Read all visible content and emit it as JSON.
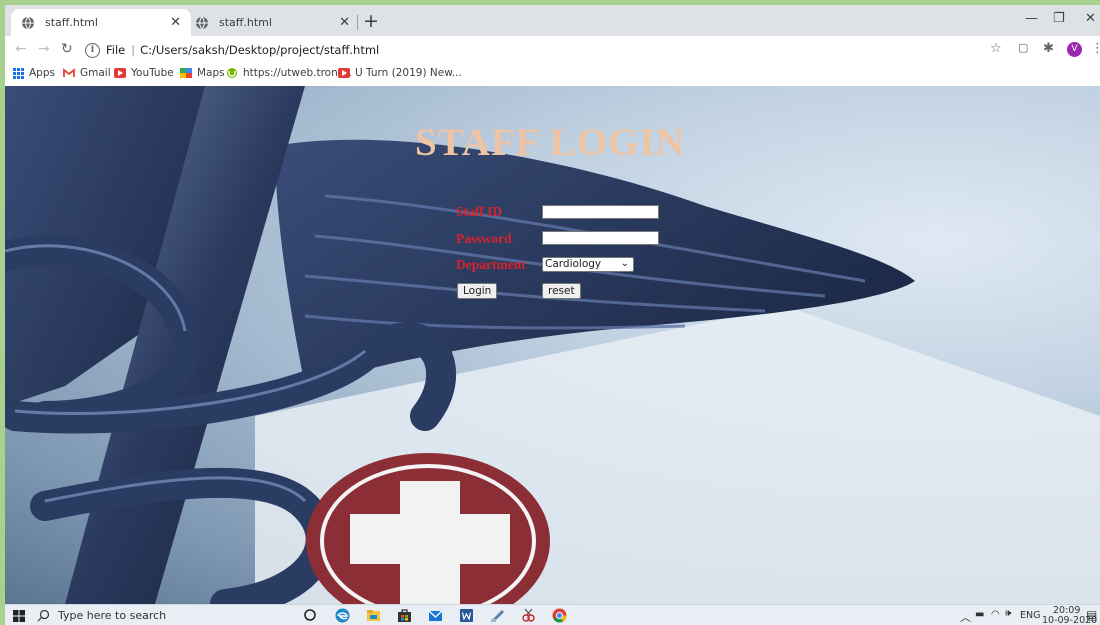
{
  "browser": {
    "tabs": [
      {
        "title": "staff.html",
        "active": true
      },
      {
        "title": "staff.html",
        "active": false
      }
    ],
    "address": {
      "scheme": "File",
      "url": "C:/Users/saksh/Desktop/project/staff.html"
    },
    "profile_initial": "V",
    "bookmarks": [
      {
        "label": "Apps",
        "icon": "apps-grid-icon"
      },
      {
        "label": "Gmail",
        "icon": "gmail-icon"
      },
      {
        "label": "YouTube",
        "icon": "youtube-icon"
      },
      {
        "label": "Maps",
        "icon": "maps-icon"
      },
      {
        "label": "https://utweb.tront...",
        "icon": "utweb-icon"
      },
      {
        "label": "U Turn (2019) New...",
        "icon": "youtube-icon"
      }
    ]
  },
  "page": {
    "title": "STAFF LOGIN",
    "form": {
      "staff_id_label": "Staff ID",
      "staff_id_value": "",
      "password_label": "Password",
      "password_value": "",
      "department_label": "Department",
      "department_selected": "Cardiology",
      "login_button": "Login",
      "reset_button": "reset"
    }
  },
  "taskbar": {
    "search_placeholder": "Type here to search",
    "language": "ENG",
    "time": "20:09",
    "date": "10-09-2020"
  },
  "colors": {
    "title": "#eec4a4",
    "label": "#d8232a",
    "outer_border": "#a9d18e"
  }
}
